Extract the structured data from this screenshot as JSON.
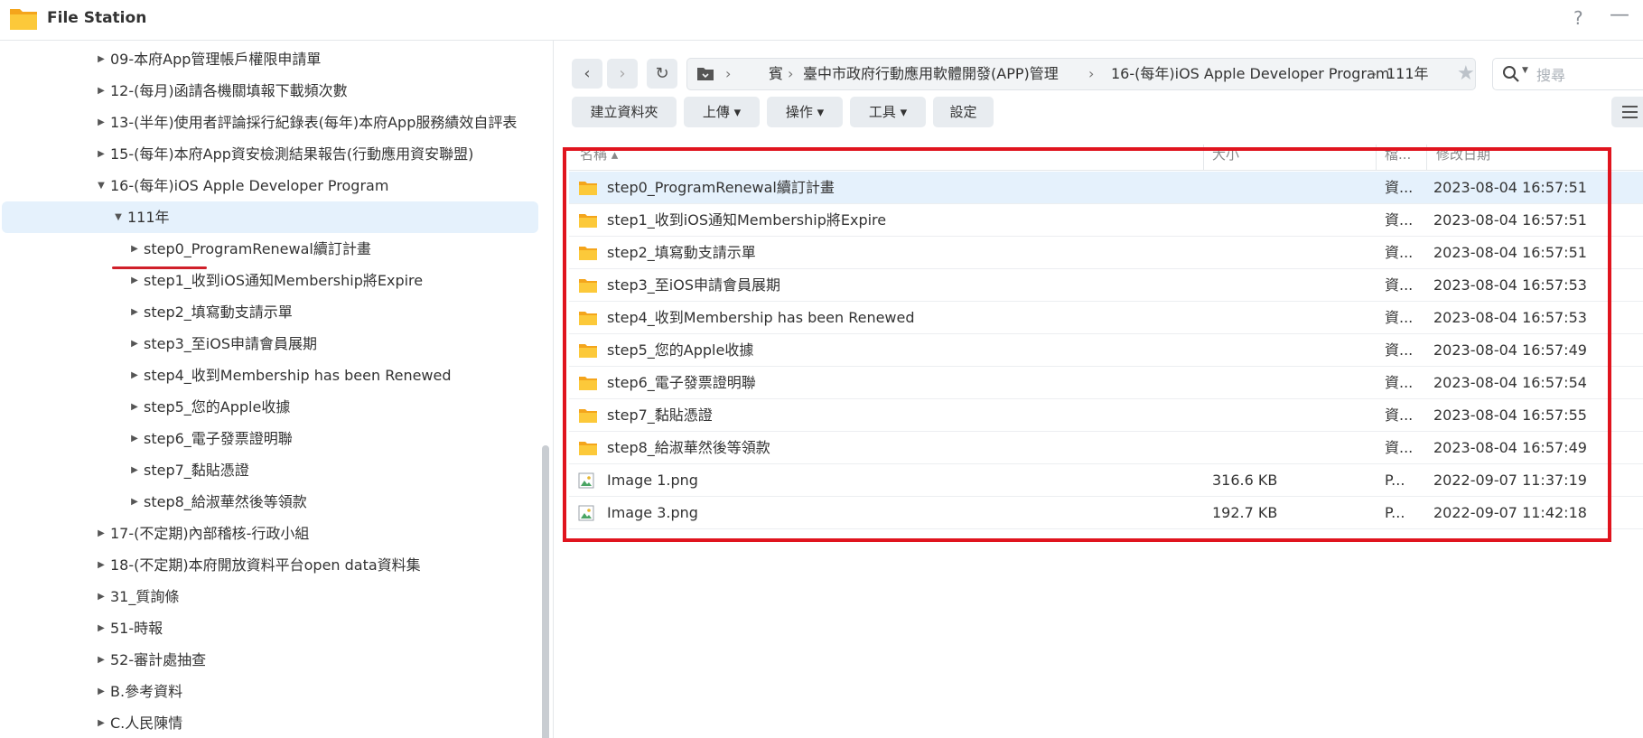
{
  "app": {
    "title": "File Station",
    "help": "?",
    "minimize": "—"
  },
  "tree": {
    "items": [
      {
        "label": "09-本府App管理帳戶權限申請單",
        "depth": 1,
        "expanded": false
      },
      {
        "label": "12-(每月)函請各機關填報下載頻次數",
        "depth": 1,
        "expanded": false
      },
      {
        "label": "13-(半年)使用者評論採行紀錄表(每年)本府App服務績效自評表",
        "depth": 1,
        "expanded": false
      },
      {
        "label": "15-(每年)本府App資安檢測結果報告(行動應用資安聯盟)",
        "depth": 1,
        "expanded": false
      },
      {
        "label": "16-(每年)iOS Apple Developer Program",
        "depth": 1,
        "expanded": true
      },
      {
        "label": "111年",
        "depth": 2,
        "expanded": true,
        "selected": true
      },
      {
        "label": "step0_ProgramRenewal續訂計畫",
        "depth": 3,
        "expanded": false
      },
      {
        "label": "step1_收到iOS通知Membership將Expire",
        "depth": 3,
        "expanded": false
      },
      {
        "label": "step2_填寫動支請示單",
        "depth": 3,
        "expanded": false
      },
      {
        "label": "step3_至iOS申請會員展期",
        "depth": 3,
        "expanded": false
      },
      {
        "label": "step4_收到Membership has been Renewed",
        "depth": 3,
        "expanded": false
      },
      {
        "label": "step5_您的Apple收據",
        "depth": 3,
        "expanded": false
      },
      {
        "label": "step6_電子發票證明聯",
        "depth": 3,
        "expanded": false
      },
      {
        "label": "step7_黏貼憑證",
        "depth": 3,
        "expanded": false
      },
      {
        "label": "step8_給淑華然後等領款",
        "depth": 3,
        "expanded": false
      },
      {
        "label": "17-(不定期)內部稽核-行政小組",
        "depth": 1,
        "expanded": false
      },
      {
        "label": "18-(不定期)本府開放資料平台open data資料集",
        "depth": 1,
        "expanded": false
      },
      {
        "label": "31_質詢條",
        "depth": 1,
        "expanded": false
      },
      {
        "label": "51-時報",
        "depth": 1,
        "expanded": false
      },
      {
        "label": "52-審計處抽查",
        "depth": 1,
        "expanded": false
      },
      {
        "label": "B.參考資料",
        "depth": 1,
        "expanded": false
      },
      {
        "label": "C.人民陳情",
        "depth": 1,
        "expanded": false
      }
    ]
  },
  "nav": {
    "back": "‹",
    "forward": "›",
    "refresh": "↻"
  },
  "path": {
    "segments": [
      "賓",
      "臺中市政府行動應用軟體開發(APP)管理",
      "16-(每年)iOS Apple Developer Program",
      "111年"
    ],
    "separator": "›"
  },
  "search": {
    "placeholder": "搜尋"
  },
  "toolbar": {
    "create_folder": "建立資料夾",
    "upload": "上傳 ▾",
    "action": "操作 ▾",
    "tools": "工具 ▾",
    "settings": "設定"
  },
  "columns": {
    "name": "名稱 ▴",
    "size": "大小",
    "type": "檔...",
    "modified": "修改日期"
  },
  "files": [
    {
      "name": "step0_ProgramRenewal續訂計畫",
      "size": "",
      "type": "資...",
      "modified": "2023-08-04 16:57:51",
      "kind": "folder",
      "selected": true
    },
    {
      "name": "step1_收到iOS通知Membership將Expire",
      "size": "",
      "type": "資...",
      "modified": "2023-08-04 16:57:51",
      "kind": "folder"
    },
    {
      "name": "step2_填寫動支請示單",
      "size": "",
      "type": "資...",
      "modified": "2023-08-04 16:57:51",
      "kind": "folder"
    },
    {
      "name": "step3_至iOS申請會員展期",
      "size": "",
      "type": "資...",
      "modified": "2023-08-04 16:57:53",
      "kind": "folder"
    },
    {
      "name": "step4_收到Membership has been Renewed",
      "size": "",
      "type": "資...",
      "modified": "2023-08-04 16:57:53",
      "kind": "folder"
    },
    {
      "name": "step5_您的Apple收據",
      "size": "",
      "type": "資...",
      "modified": "2023-08-04 16:57:49",
      "kind": "folder"
    },
    {
      "name": "step6_電子發票證明聯",
      "size": "",
      "type": "資...",
      "modified": "2023-08-04 16:57:54",
      "kind": "folder"
    },
    {
      "name": "step7_黏貼憑證",
      "size": "",
      "type": "資...",
      "modified": "2023-08-04 16:57:55",
      "kind": "folder"
    },
    {
      "name": "step8_給淑華然後等領款",
      "size": "",
      "type": "資...",
      "modified": "2023-08-04 16:57:49",
      "kind": "folder"
    },
    {
      "name": "Image 1.png",
      "size": "316.6 KB",
      "type": "P...",
      "modified": "2022-09-07 11:37:19",
      "kind": "image"
    },
    {
      "name": "Image 3.png",
      "size": "192.7 KB",
      "type": "P...",
      "modified": "2022-09-07 11:42:18",
      "kind": "image"
    }
  ],
  "colors": {
    "accent": "#e5f1fc",
    "highlight": "#e0141e",
    "folder": "#f7b928"
  }
}
